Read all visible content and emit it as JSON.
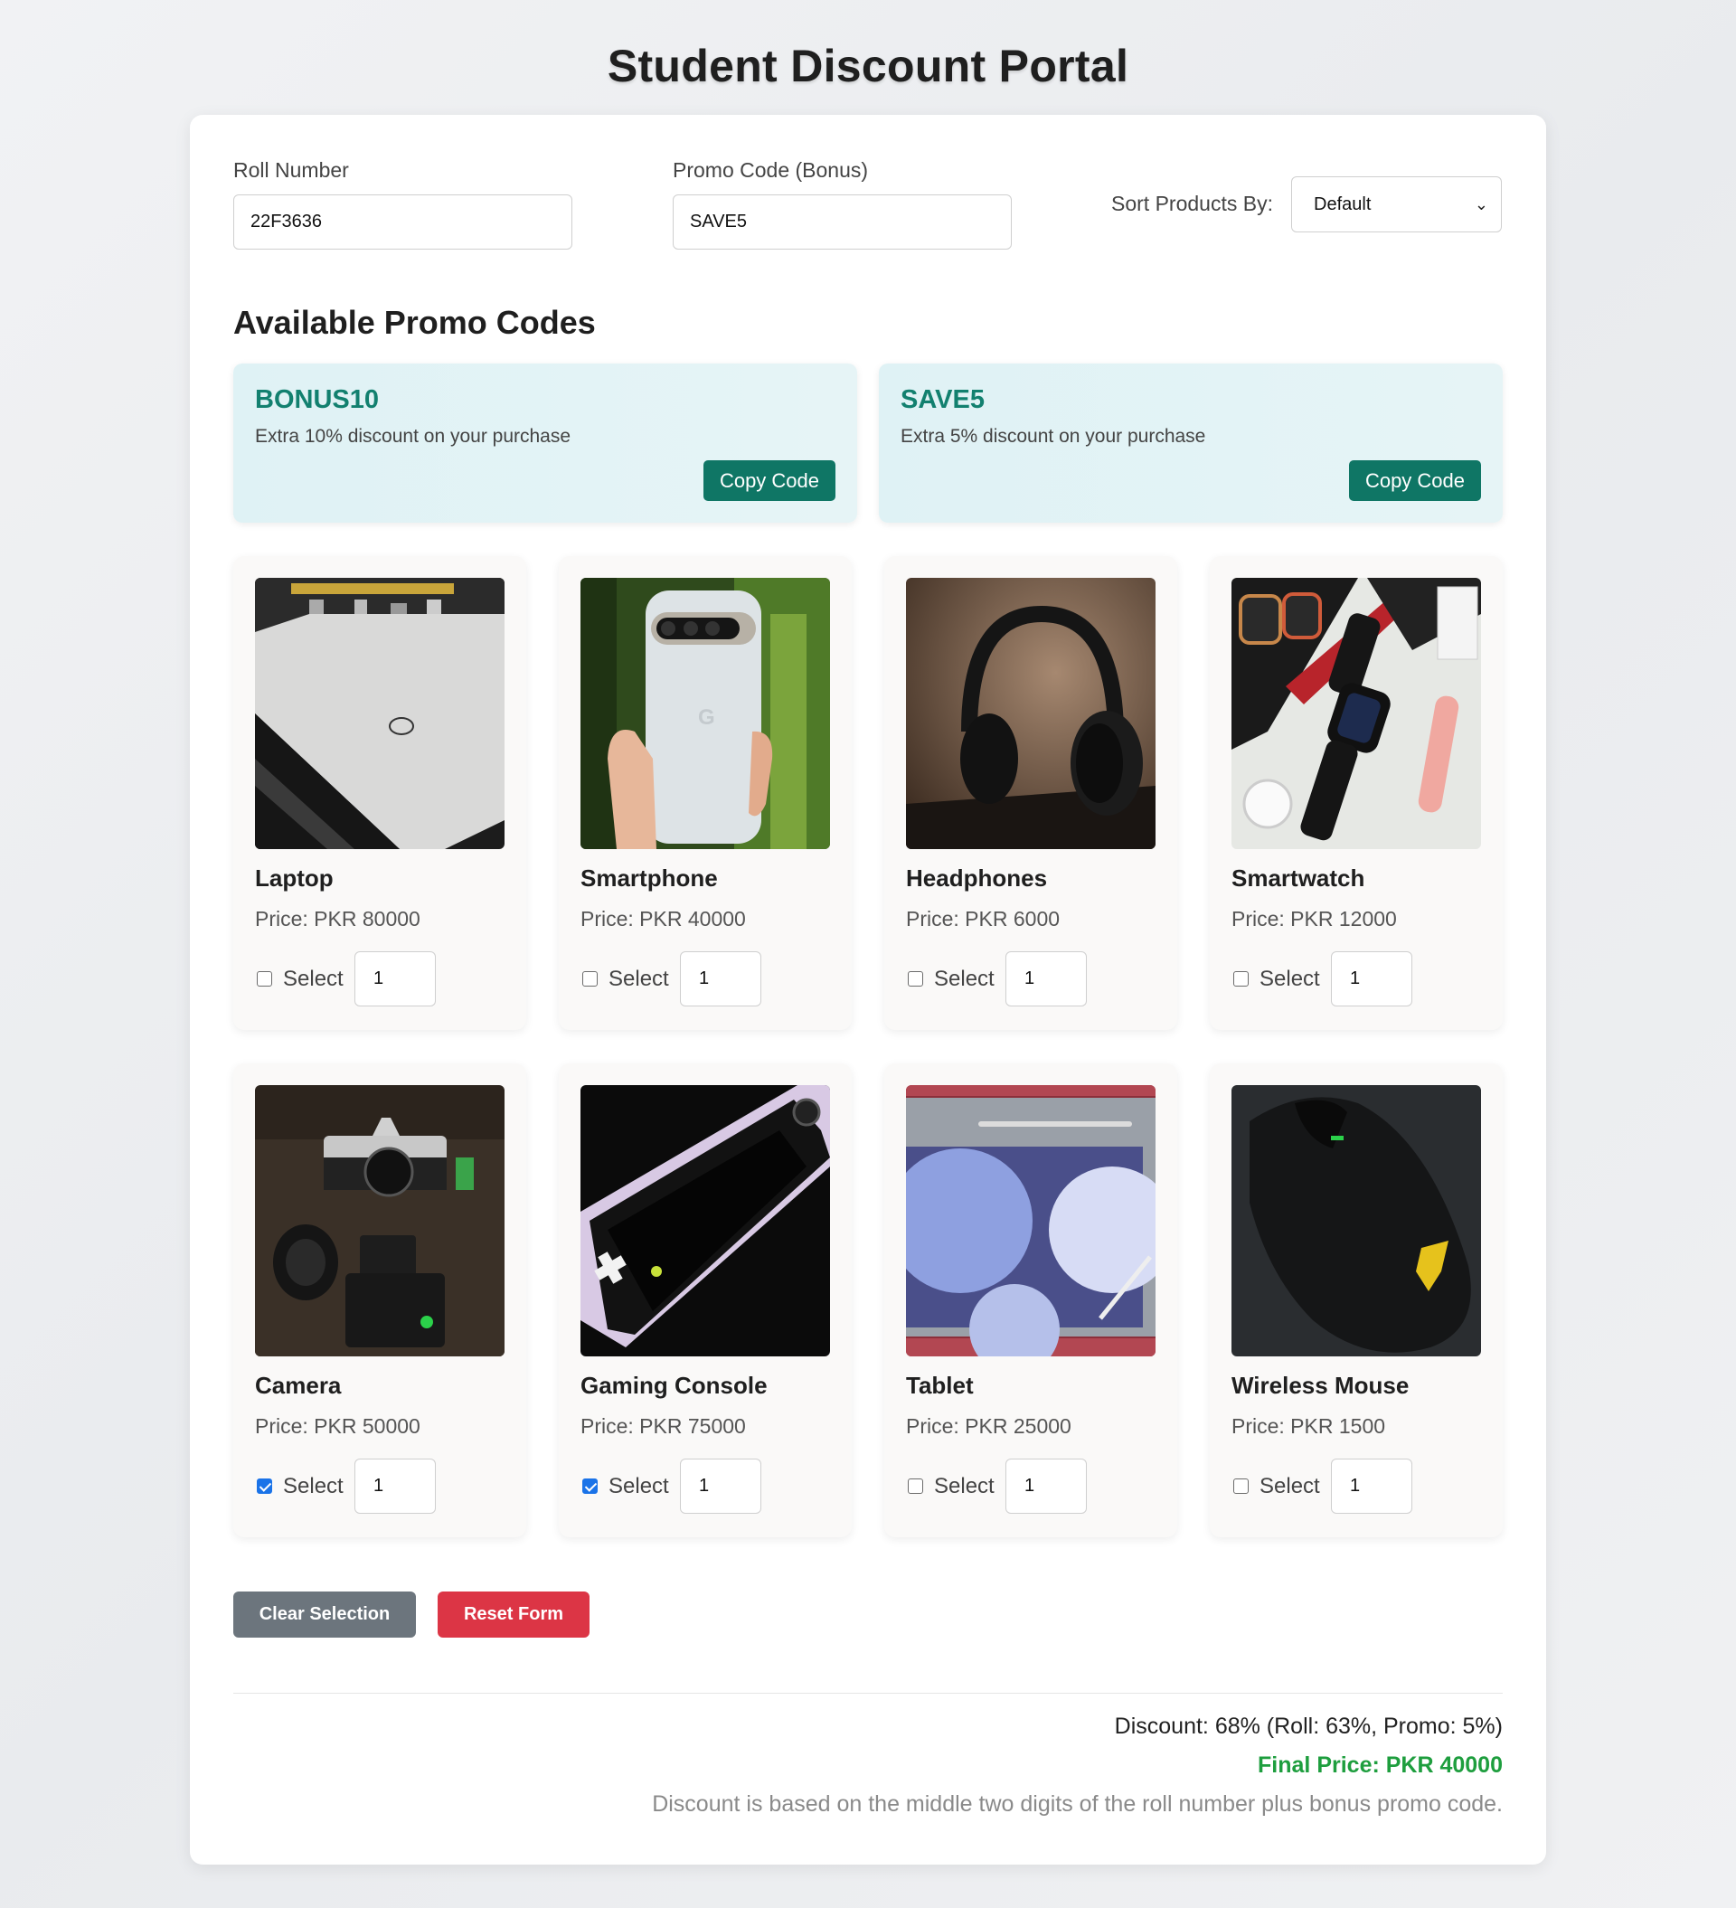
{
  "header": {
    "title": "Student Discount Portal"
  },
  "form": {
    "roll_label": "Roll Number",
    "roll_value": "22F3636",
    "promo_label": "Promo Code (Bonus)",
    "promo_value": "SAVE5",
    "sort_label": "Sort Products By:",
    "sort_value": "Default"
  },
  "promos": {
    "heading": "Available Promo Codes",
    "items": [
      {
        "code": "BONUS10",
        "desc": "Extra 10% discount on your purchase",
        "button": "Copy Code"
      },
      {
        "code": "SAVE5",
        "desc": "Extra 5% discount on your purchase",
        "button": "Copy Code"
      }
    ]
  },
  "products": [
    {
      "name": "Laptop",
      "price": "Price: PKR 80000",
      "select_label": "Select",
      "qty": "1",
      "selected": false,
      "image": "laptop"
    },
    {
      "name": "Smartphone",
      "price": "Price: PKR 40000",
      "select_label": "Select",
      "qty": "1",
      "selected": false,
      "image": "smartphone"
    },
    {
      "name": "Headphones",
      "price": "Price: PKR 6000",
      "select_label": "Select",
      "qty": "1",
      "selected": false,
      "image": "headphones"
    },
    {
      "name": "Smartwatch",
      "price": "Price: PKR 12000",
      "select_label": "Select",
      "qty": "1",
      "selected": false,
      "image": "smartwatch"
    },
    {
      "name": "Camera",
      "price": "Price: PKR 50000",
      "select_label": "Select",
      "qty": "1",
      "selected": true,
      "image": "camera"
    },
    {
      "name": "Gaming Console",
      "price": "Price: PKR 75000",
      "select_label": "Select",
      "qty": "1",
      "selected": true,
      "image": "gaming-console"
    },
    {
      "name": "Tablet",
      "price": "Price: PKR 25000",
      "select_label": "Select",
      "qty": "1",
      "selected": false,
      "image": "tablet"
    },
    {
      "name": "Wireless Mouse",
      "price": "Price: PKR 1500",
      "select_label": "Select",
      "qty": "1",
      "selected": false,
      "image": "wireless-mouse"
    }
  ],
  "actions": {
    "clear": "Clear Selection",
    "reset": "Reset Form"
  },
  "summary": {
    "discount": "Discount: 68% (Roll: 63%, Promo: 5%)",
    "final": "Final Price: PKR 40000",
    "note": "Discount is based on the middle two digits of the roll number plus bonus promo code."
  },
  "colors": {
    "promo_accent": "#12806f",
    "copy_button": "#0f7665",
    "clear_button": "#6c757d",
    "reset_button": "#dc3545",
    "final_price": "#1e9e3e",
    "checkbox_checked": "#1a73e8"
  },
  "icons": {
    "select_chevron": "chevron-down-icon"
  }
}
